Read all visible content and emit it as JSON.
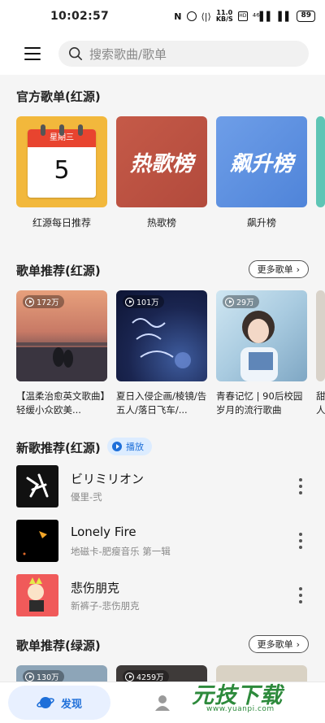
{
  "status_bar": {
    "time": "10:02:57",
    "speed_top": "11.0",
    "speed_bottom": "KB/S",
    "network": "⁴⁶",
    "battery": "89"
  },
  "search": {
    "placeholder": "搜索歌曲/歌单"
  },
  "official": {
    "title": "官方歌单(红源)",
    "calendar": {
      "weekday": "星期三",
      "day": "5"
    },
    "cards": [
      {
        "label": "红源每日推荐"
      },
      {
        "label": "热歌榜",
        "cover_text": "热歌榜"
      },
      {
        "label": "飙升榜",
        "cover_text": "飙升榜"
      }
    ]
  },
  "recommend_red": {
    "title": "歌单推荐(红源)",
    "more": "更多歌单",
    "cards": [
      {
        "plays": "172万",
        "title": "【温柔治愈英文歌曲】轻缓小众欧美..."
      },
      {
        "plays": "101万",
        "title": "夏日入侵企画/棱镜/告五人/落日飞车/..."
      },
      {
        "plays": "29万",
        "title": "青春记忆 | 90后校园岁月的流行歌曲"
      },
      {
        "plays": "",
        "title": "甜人"
      }
    ]
  },
  "new_songs": {
    "title": "新歌推荐(红源)",
    "play_label": "播放",
    "songs": [
      {
        "name": "ビリミリオン",
        "artist": "優里-弐"
      },
      {
        "name": "Lonely Fire",
        "artist": "地磁卡-肥瘦音乐 第一辑"
      },
      {
        "name": "悲伤朋克",
        "artist": "新裤子-悲伤朋克"
      }
    ]
  },
  "recommend_green": {
    "title": "歌单推荐(绿源)",
    "more": "更多歌单",
    "plays": [
      "130万",
      "4259万"
    ]
  },
  "bottom_nav": {
    "discover": "发现"
  },
  "watermark": {
    "text": "元技下载",
    "url": "www.yuanpi.com"
  },
  "colors": {
    "accent": "#1e6fd9",
    "calendar_red": "#e8442f",
    "watermark_green": "#2d8a3c"
  }
}
